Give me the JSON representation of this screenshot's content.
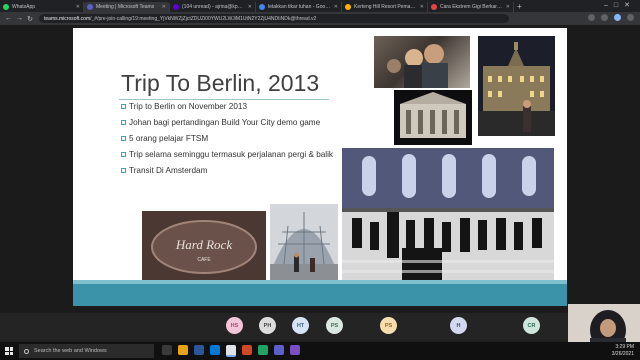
{
  "browser": {
    "tabs": [
      {
        "label": "WhatsApp",
        "color": "#25d366"
      },
      {
        "label": "Meeting | Microsoft Teams",
        "color": "#5b5fc7",
        "active": true
      },
      {
        "label": "(104 unread) - ajrina@kpm...",
        "color": "#6001d2"
      },
      {
        "label": "letakkan tikar tuhan - Google...",
        "color": "#4285f4"
      },
      {
        "label": "Kerteng Hill Resort Pemak Ka...",
        "color": "#ffb400"
      },
      {
        "label": "Cara Ekstrem Gigi Berkarat K...",
        "color": "#e8453c"
      }
    ],
    "url_host": "teams.microsoft.com",
    "url_path": "/_#/pre-join-calling/19:meeting_YjVkNWZjZjctZDUZi00YWU2LWJiM1UtN2Y2ZjU4NDIiNDk@thread.v2"
  },
  "slide": {
    "title": "Trip To Berlin, 2013",
    "bullets": [
      "Trip to Berlin on November 2013",
      "Johan bagi pertandingan Build Your City demo game",
      "5 orang pelajar FTSM",
      "Trip selama seminggu termasuk perjalanan pergi & balik",
      "Transit Di Amsterdam"
    ],
    "photos": {
      "hardrock_text": "Hard Rock",
      "hardrock_sub": "CAFE"
    }
  },
  "participants": [
    {
      "initials": "HS",
      "bg": "#f2c6d8",
      "fg": "#b0487a"
    },
    {
      "initials": "PH",
      "bg": "#dcdcdc",
      "fg": "#444444"
    },
    {
      "initials": "HT",
      "bg": "#d6e4f5",
      "fg": "#3a5f8f"
    },
    {
      "initials": "PS",
      "bg": "#d9e8e0",
      "fg": "#3d6b52"
    },
    {
      "initials": "PS",
      "bg": "#f6ddb0",
      "fg": "#9a6410"
    },
    {
      "initials": "H",
      "bg": "#d3d8f0",
      "fg": "#3d4a8a"
    },
    {
      "initials": "CR",
      "bg": "#cfe6dc",
      "fg": "#2f6b55"
    }
  ],
  "taskbar": {
    "search_placeholder": "Search the web and Windows",
    "time": "3:29 PM",
    "date": "3/26/2021"
  }
}
